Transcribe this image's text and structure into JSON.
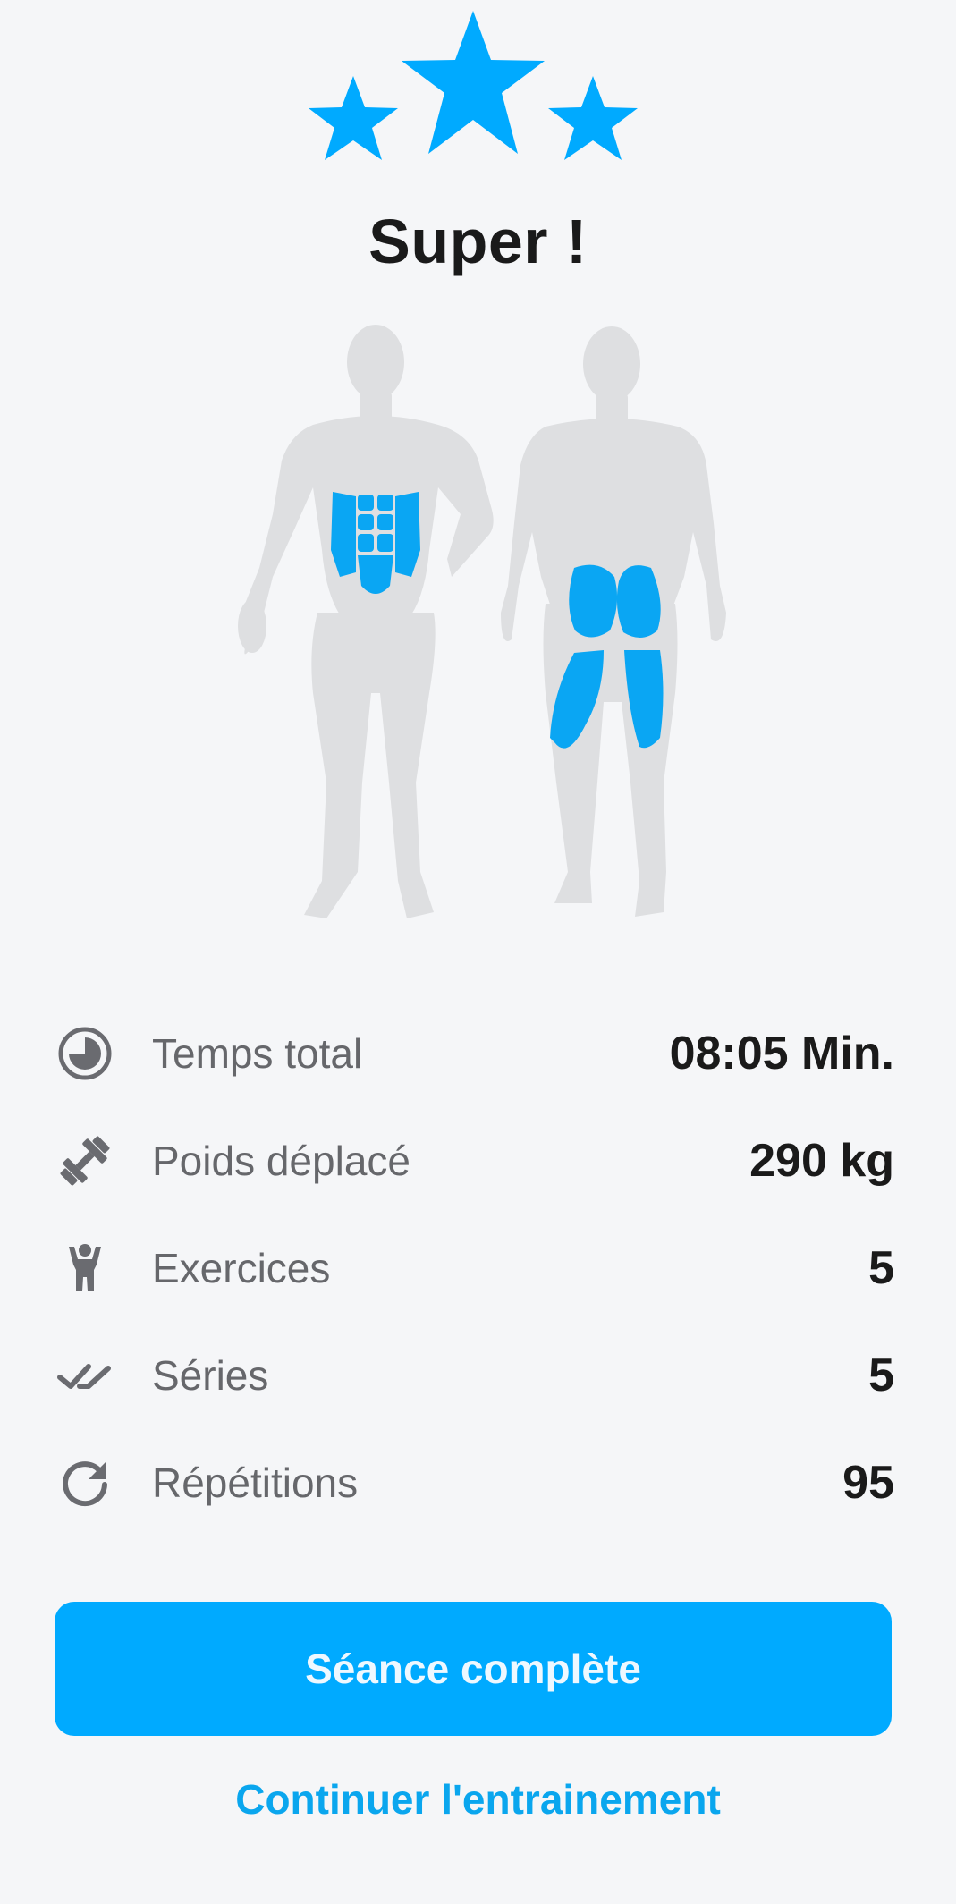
{
  "header": {
    "rating_stars": 3,
    "title": "Super !"
  },
  "muscle_map": {
    "highlighted": [
      "abs",
      "glutes",
      "hamstrings"
    ],
    "highlight_color": "#0aa6f3",
    "body_color": "#dedfe1"
  },
  "stats": [
    {
      "icon": "timer-icon",
      "label": "Temps total",
      "value": "08:05 Min."
    },
    {
      "icon": "dumbbell-icon",
      "label": "Poids déplacé",
      "value": "290 kg"
    },
    {
      "icon": "person-icon",
      "label": "Exercices",
      "value": "5"
    },
    {
      "icon": "double-check-icon",
      "label": "Séries",
      "value": "5"
    },
    {
      "icon": "refresh-icon",
      "label": "Répétitions",
      "value": "95"
    }
  ],
  "actions": {
    "primary_label": "Séance complète",
    "secondary_label": "Continuer l'entrainement"
  },
  "colors": {
    "accent": "#00aaff",
    "background": "#f5f6f8",
    "text_primary": "#1a1a1a",
    "text_secondary": "#66676b"
  }
}
